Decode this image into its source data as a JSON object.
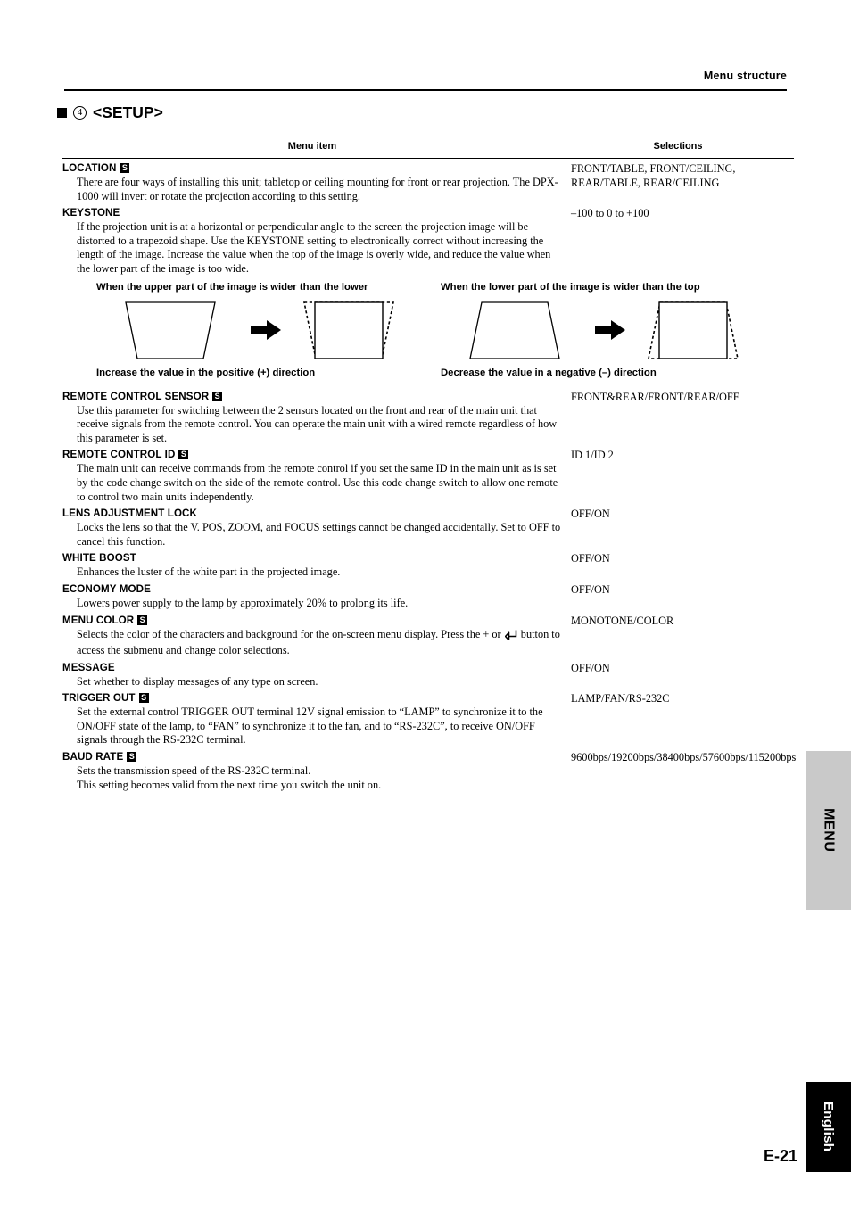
{
  "header": {
    "running_head": "Menu structure"
  },
  "section": {
    "bullet": "black-square",
    "number": "4",
    "title": "<SETUP>"
  },
  "table": {
    "columns": {
      "item": "Menu item",
      "selections": "Selections"
    },
    "rows": [
      {
        "name": "LOCATION",
        "badge": "S",
        "desc": "There are four ways of installing this unit; tabletop or ceiling mounting for front or rear projection. The DPX-1000 will invert or rotate the projection according to this setting.",
        "selections": "FRONT/TABLE, FRONT/CEILING, REAR/TABLE, REAR/CEILING"
      },
      {
        "name": "KEYSTONE",
        "badge": "",
        "desc": "If the projection unit is at a horizontal or perpendicular angle to the screen the projection image will be distorted to a trapezoid shape. Use the KEYSTONE setting to electronically correct without increasing the length of the image. Increase the value when the top of the image is overly wide, and reduce the value when the lower part of the image is too wide.",
        "selections": "–100 to 0 to +100"
      },
      {
        "name": "REMOTE CONTROL SENSOR",
        "badge": "S",
        "desc": "Use this parameter for switching between the 2 sensors located on the front and rear of the main unit that receive signals from the remote control. You can operate the main unit with a wired remote regardless of how this parameter is set.",
        "selections": "FRONT&REAR/FRONT/REAR/OFF"
      },
      {
        "name": "REMOTE CONTROL ID",
        "badge": "S",
        "desc": "The main unit can receive commands from the remote control if you set the same ID in the main unit as is set by the code change switch on the side of the remote control. Use this code change switch to allow one remote to control two main units independently.",
        "selections": "ID 1/ID 2"
      },
      {
        "name": "LENS ADJUSTMENT LOCK",
        "badge": "",
        "desc": "Locks the lens so that the V. POS, ZOOM, and FOCUS settings cannot be changed accidentally. Set to OFF to cancel this function.",
        "selections": "OFF/ON"
      },
      {
        "name": "WHITE BOOST",
        "badge": "",
        "desc": "Enhances the luster of the white part in the projected image.",
        "selections": "OFF/ON"
      },
      {
        "name": "ECONOMY MODE",
        "badge": "",
        "desc": "Lowers power supply to the lamp by approximately 20% to prolong its life.",
        "selections": "OFF/ON"
      },
      {
        "name": "MENU COLOR",
        "badge": "S",
        "desc_before_icon": "Selects the color of the characters and background for the on-screen menu display. Press the + or ",
        "desc_icon": "enter-key-icon",
        "desc_after_icon": " button to access the submenu and change color selections.",
        "selections": "MONOTONE/COLOR"
      },
      {
        "name": "MESSAGE",
        "badge": "",
        "desc": "Set whether to display messages of any type on screen.",
        "selections": "OFF/ON"
      },
      {
        "name": "TRIGGER OUT",
        "badge": "S",
        "desc": "Set the external control TRIGGER OUT terminal 12V signal emission to “LAMP” to synchronize it to the ON/OFF state of the lamp, to “FAN” to synchronize it to the fan, and to “RS-232C”, to receive ON/OFF signals through the RS-232C terminal.",
        "selections": "LAMP/FAN/RS-232C"
      },
      {
        "name": "BAUD RATE",
        "badge": "S",
        "desc": "Sets the transmission speed of the RS-232C terminal.\nThis setting becomes valid from the next time you switch the unit on.",
        "selections": "9600bps/19200bps/38400bps/57600bps/115200bps"
      }
    ]
  },
  "keystone_figures": {
    "left": {
      "caption_top": "When the upper part of the image is wider than the lower",
      "caption_bottom": "Increase the value in the positive (+) direction"
    },
    "right": {
      "caption_top": "When the lower part of the image is wider than the top",
      "caption_bottom": "Decrease the value in a negative (–) direction"
    },
    "arrow": "right-arrow-icon"
  },
  "side_tabs": {
    "menu": "MENU",
    "language": "English"
  },
  "page_number": "E-21"
}
